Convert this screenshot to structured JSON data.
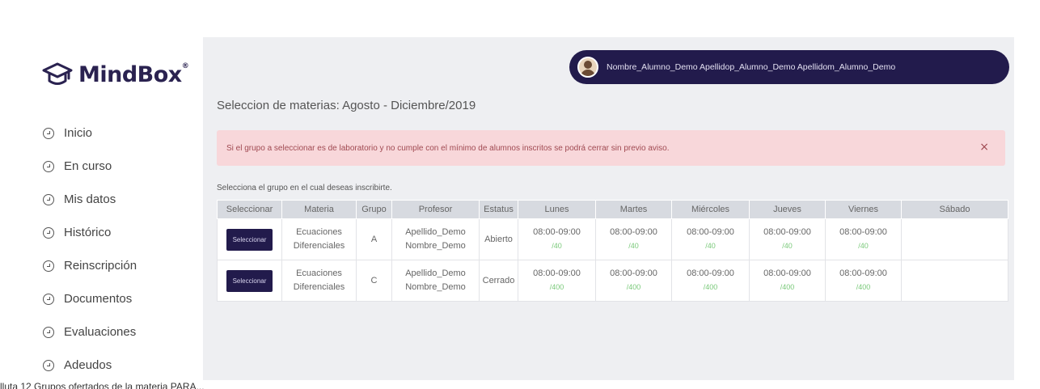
{
  "app": {
    "name": "MindBox",
    "reg": "®"
  },
  "nav": [
    {
      "label": "Inicio"
    },
    {
      "label": "En curso"
    },
    {
      "label": "Mis datos"
    },
    {
      "label": "Histórico"
    },
    {
      "label": "Reinscripción"
    },
    {
      "label": "Documentos"
    },
    {
      "label": "Evaluaciones"
    },
    {
      "label": "Adeudos"
    }
  ],
  "user": {
    "name": "Nombre_Alumno_Demo Apellidop_Alumno_Demo Apellidom_Alumno_Demo"
  },
  "page": {
    "title": "Seleccion de materias: Agosto - Diciembre/2019",
    "alert": "Si el grupo a seleccionar es de laboratorio y no cumple con el mínimo de alumnos inscritos se podrá cerrar sin previo aviso.",
    "alert_close": "×",
    "instruction": "Selecciona el grupo en el cual deseas inscribirte."
  },
  "table": {
    "headers": [
      "Seleccionar",
      "Materia",
      "Grupo",
      "Profesor",
      "Estatus",
      "Lunes",
      "Martes",
      "Miércoles",
      "Jueves",
      "Viernes",
      "Sábado"
    ],
    "rows": [
      {
        "button": "Seleccionar",
        "materia": [
          "Ecuaciones",
          "Diferenciales"
        ],
        "grupo": "A",
        "profesor": [
          "Apellido_Demo",
          "Nombre_Demo"
        ],
        "estatus": "Abierto",
        "slots": [
          {
            "time": "08:00-09:00",
            "cupo": "/40"
          },
          {
            "time": "08:00-09:00",
            "cupo": "/40"
          },
          {
            "time": "08:00-09:00",
            "cupo": "/40"
          },
          {
            "time": "08:00-09:00",
            "cupo": "/40"
          },
          {
            "time": "08:00-09:00",
            "cupo": "/40"
          }
        ],
        "sabado": ""
      },
      {
        "button": "Seleccionar",
        "materia": [
          "Ecuaciones",
          "Diferenciales"
        ],
        "grupo": "C",
        "profesor": [
          "Apellido_Demo",
          "Nombre_Demo"
        ],
        "estatus": "Cerrado",
        "slots": [
          {
            "time": "08:00-09:00",
            "cupo": "/400"
          },
          {
            "time": "08:00-09:00",
            "cupo": "/400"
          },
          {
            "time": "08:00-09:00",
            "cupo": "/400"
          },
          {
            "time": "08:00-09:00",
            "cupo": "/400"
          },
          {
            "time": "08:00-09:00",
            "cupo": "/400"
          }
        ],
        "sabado": ""
      }
    ]
  },
  "caption": "lluta 12 Grupos ofertados de la materia PARA..."
}
